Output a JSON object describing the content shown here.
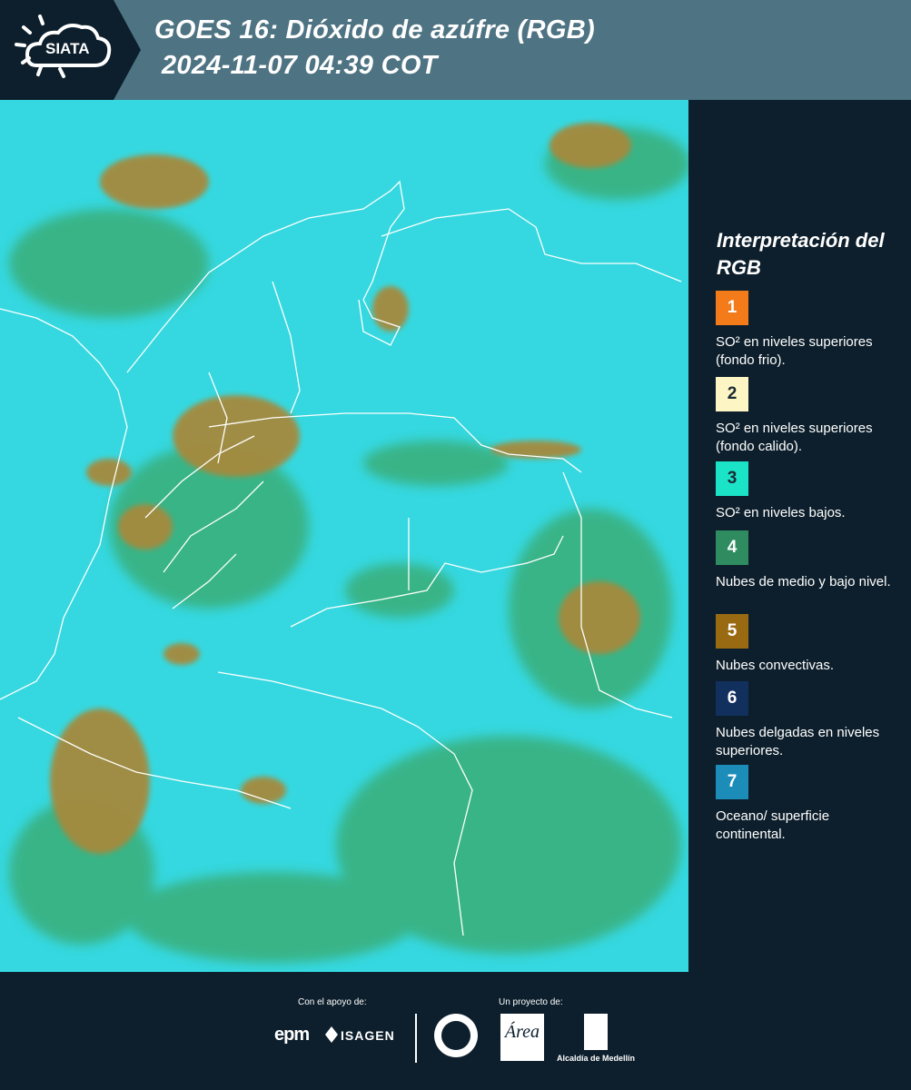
{
  "header": {
    "logo_text": "SIATA",
    "title_line1": "GOES 16: Dióxido de azúfre (RGB)",
    "title_line2": "2024-11-07 04:39 COT"
  },
  "map": {
    "product": "GOES 16 SO2 RGB satellite composite",
    "colors": {
      "background_surface": "#35d8e0",
      "low_cloud": "#3ba86a",
      "convective_cloud": "#a58a3e",
      "boundaries": "#ffffff"
    }
  },
  "legend": {
    "title": "Interpretación del RGB",
    "items": [
      {
        "number": "1",
        "color": "#f47b1a",
        "text": "SO² en niveles superiores (fondo frio)."
      },
      {
        "number": "2",
        "color": "#fdf5c4",
        "text": "SO² en niveles superiores (fondo calido)."
      },
      {
        "number": "3",
        "color": "#1ae3c8",
        "text": "SO² en niveles bajos."
      },
      {
        "number": "4",
        "color": "#2e8c60",
        "text": "Nubes de medio y bajo nivel."
      },
      {
        "number": "5",
        "color": "#9a6a12",
        "text": "Nubes convectivas."
      },
      {
        "number": "6",
        "color": "#12305e",
        "text": "Nubes delgadas en niveles superiores."
      },
      {
        "number": "7",
        "color": "#1c8cb8",
        "text": "Oceano/ superficie continental."
      }
    ]
  },
  "footer": {
    "support_label": "Con el apoyo de:",
    "project_label": "Un proyecto de:",
    "sponsors": [
      "epm",
      "ISAGEN"
    ],
    "partners": [
      "Área Metropolitana Valle de Aburrá",
      "Alcaldía de Medellín"
    ],
    "area_logo_text": "Área",
    "alcaldia_text": "Alcaldía de Medellín"
  }
}
